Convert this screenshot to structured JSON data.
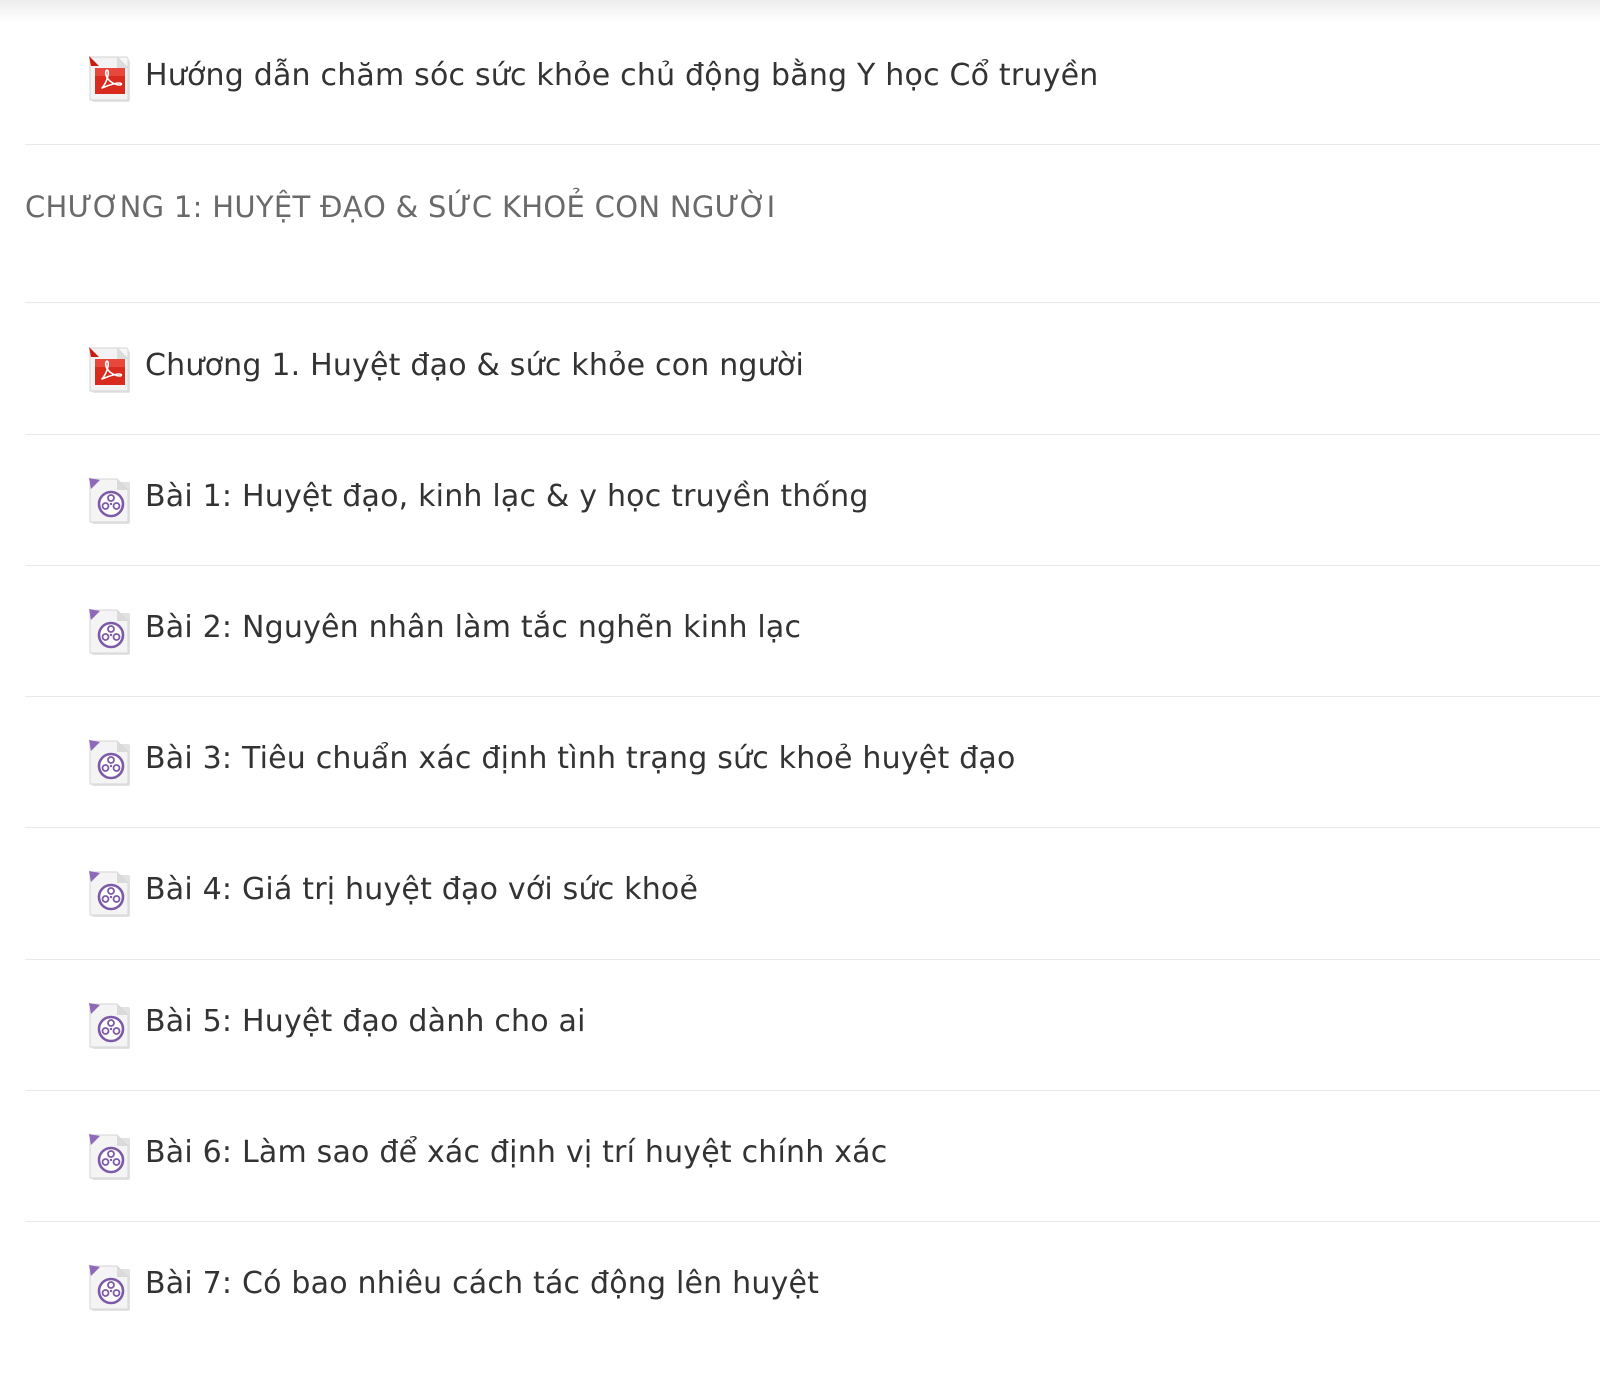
{
  "intro_item": {
    "icon": "pdf-icon",
    "label": "Hướng dẫn chăm sóc sức khỏe chủ động bằng Y học Cổ truyền"
  },
  "section": {
    "title": "CHƯƠNG 1: HUYỆT ĐẠO & SỨC KHOẺ CON NGƯỜI"
  },
  "items": [
    {
      "icon": "pdf-icon",
      "label": "Chương 1. Huyệt đạo & sức khỏe con người"
    },
    {
      "icon": "video-icon",
      "label": "Bài 1: Huyệt đạo, kinh lạc & y học truyền thống"
    },
    {
      "icon": "video-icon",
      "label": "Bài 2: Nguyên nhân làm tắc nghẽn kinh lạc"
    },
    {
      "icon": "video-icon",
      "label": "Bài 3: Tiêu chuẩn xác định tình trạng sức khoẻ huyệt đạo"
    },
    {
      "icon": "video-icon",
      "label": "Bài 4: Giá trị huyệt đạo với sức khoẻ"
    },
    {
      "icon": "video-icon",
      "label": "Bài 5: Huyệt đạo dành cho ai"
    },
    {
      "icon": "video-icon",
      "label": "Bài 6: Làm sao để xác định vị trí huyệt chính xác"
    },
    {
      "icon": "video-icon",
      "label": "Bài 7: Có bao nhiêu cách tác động lên huyệt"
    }
  ]
}
